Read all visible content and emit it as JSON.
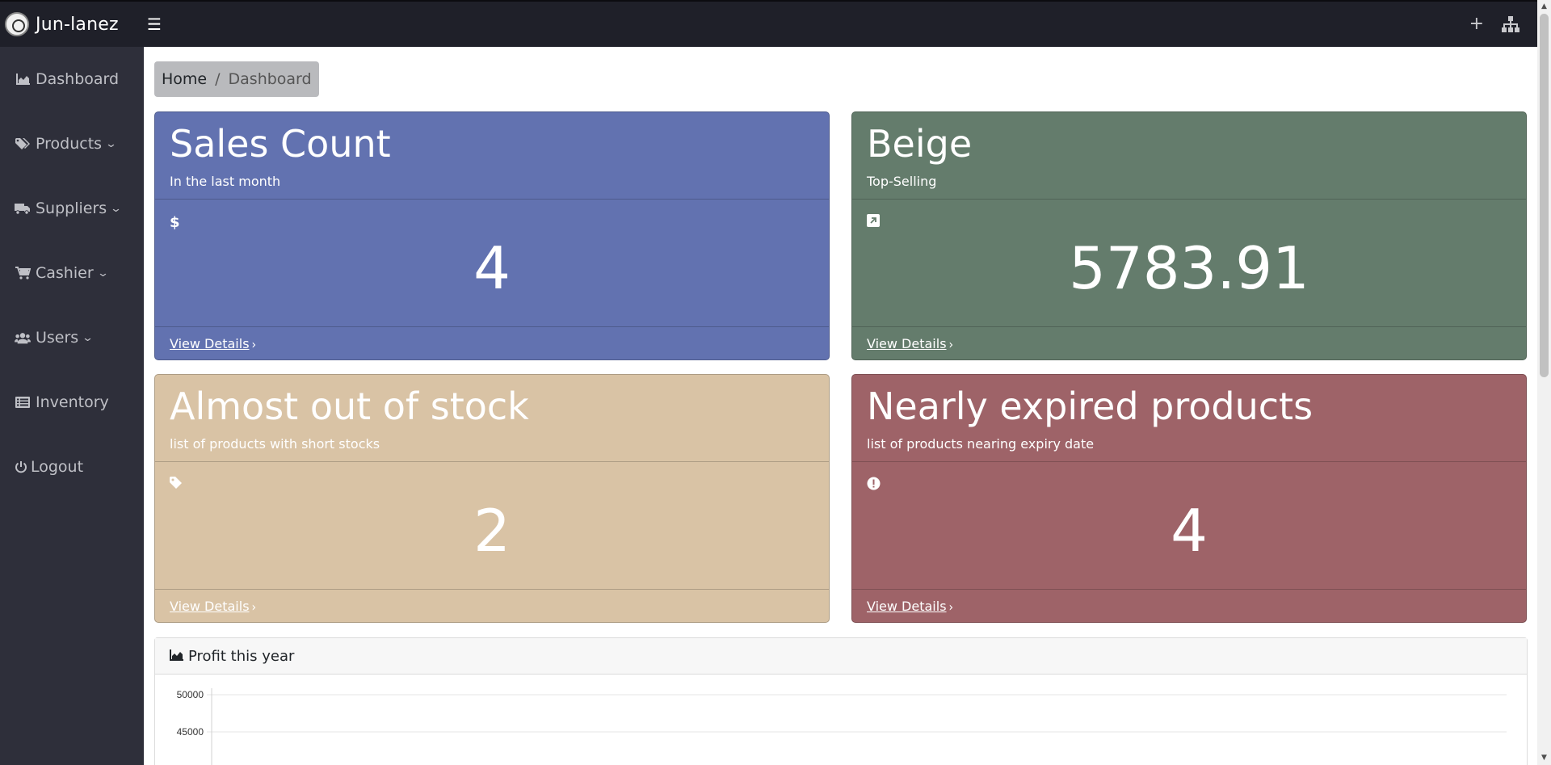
{
  "app": {
    "brand": "Jun-lanez"
  },
  "topbar": {
    "menu_icon": "hamburger-icon",
    "add_icon": "plus-icon",
    "sitemap_icon": "sitemap-icon"
  },
  "sidebar": {
    "items": [
      {
        "label": "Dashboard",
        "icon": "chart-area-icon",
        "has_submenu": false
      },
      {
        "label": "Products",
        "icon": "tags-icon",
        "has_submenu": true
      },
      {
        "label": "Suppliers",
        "icon": "truck-icon",
        "has_submenu": true
      },
      {
        "label": "Cashier",
        "icon": "cart-icon",
        "has_submenu": true
      },
      {
        "label": "Users",
        "icon": "users-icon",
        "has_submenu": true
      },
      {
        "label": "Inventory",
        "icon": "list-icon",
        "has_submenu": false
      },
      {
        "label": "Logout",
        "icon": "power-icon",
        "has_submenu": false
      }
    ]
  },
  "breadcrumb": {
    "home": "Home",
    "separator": "/",
    "current": "Dashboard"
  },
  "cards": [
    {
      "title": "Sales Count",
      "subtitle": "In the last month",
      "icon": "dollar-icon",
      "icon_glyph": "$",
      "value": "4",
      "link": "View Details",
      "color": "#6272b0"
    },
    {
      "title": "Beige",
      "subtitle": "Top-Selling",
      "icon": "external-link-icon",
      "icon_glyph": "↗",
      "value": "5783.91",
      "link": "View Details",
      "color": "#647c6c"
    },
    {
      "title": "Almost out of stock",
      "subtitle": "list of products with short stocks",
      "icon": "tag-icon",
      "icon_glyph": "🏷",
      "value": "2",
      "link": "View Details",
      "color": "#d9c3a5"
    },
    {
      "title": "Nearly expired products",
      "subtitle": "list of products nearing expiry date",
      "icon": "exclamation-circle-icon",
      "icon_glyph": "!",
      "value": "4",
      "link": "View Details",
      "color": "#9e6368"
    }
  ],
  "chart_panel": {
    "title": "Profit this year",
    "icon": "chart-area-icon"
  },
  "chart_data": {
    "type": "line",
    "title": "",
    "xlabel": "",
    "ylabel": "",
    "y_ticks": [
      50000,
      45000
    ],
    "grid": true,
    "series": []
  }
}
